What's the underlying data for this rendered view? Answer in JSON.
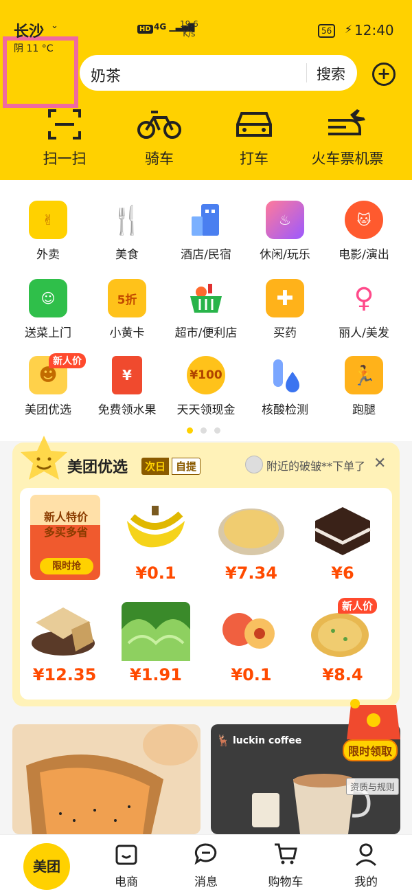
{
  "status_bar": {
    "hd": "HD",
    "network": "4G",
    "speed_value": "19.6",
    "speed_unit": "K/s",
    "battery": "56",
    "time": "12:40"
  },
  "location": {
    "city": "长沙",
    "weather": "阴 11 °C"
  },
  "search": {
    "value": "奶茶",
    "button": "搜索"
  },
  "top_nav": [
    {
      "label": "扫一扫"
    },
    {
      "label": "骑车"
    },
    {
      "label": "打车"
    },
    {
      "label": "火车票机票"
    }
  ],
  "categories": [
    {
      "label": "外卖"
    },
    {
      "label": "美食"
    },
    {
      "label": "酒店/民宿"
    },
    {
      "label": "休闲/玩乐"
    },
    {
      "label": "电影/演出"
    },
    {
      "label": "送菜上门"
    },
    {
      "label": "小黄卡",
      "icon_text": "5折"
    },
    {
      "label": "超市/便利店"
    },
    {
      "label": "买药"
    },
    {
      "label": "丽人/美发"
    },
    {
      "label": "美团优选",
      "badge": "新人价"
    },
    {
      "label": "免费领水果"
    },
    {
      "label": "天天领现金",
      "icon_text": "¥100"
    },
    {
      "label": "核酸检测"
    },
    {
      "label": "跑腿"
    }
  ],
  "youxuan": {
    "title": "美团优选",
    "tag1": "次日",
    "tag2": "自提",
    "announcement": "附近的破皱**下单了",
    "promo": {
      "line1": "新人特价",
      "line2": "多买多省",
      "button": "限时抢"
    },
    "products": [
      {
        "price": "¥0.1"
      },
      {
        "price": "¥7.34"
      },
      {
        "price": "¥6"
      },
      {
        "price": "¥12.35"
      },
      {
        "price": "¥1.91"
      },
      {
        "price": "¥0.1"
      },
      {
        "price": "¥8.4",
        "badge": "新人价"
      }
    ]
  },
  "banners": {
    "luckin": "luckin coffee",
    "float_label": "限时领取",
    "rules": "资质与规则"
  },
  "tabs": [
    {
      "label": "美团"
    },
    {
      "label": "电商"
    },
    {
      "label": "消息"
    },
    {
      "label": "购物车"
    },
    {
      "label": "我的"
    }
  ]
}
